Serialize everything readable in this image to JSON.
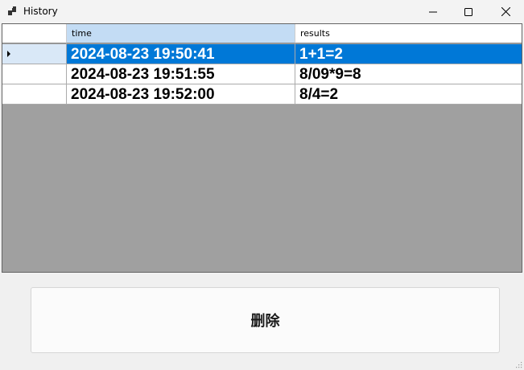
{
  "window": {
    "title": "History",
    "icons": {
      "app": "app-icon",
      "minimize": "minimize-icon",
      "maximize": "maximize-icon",
      "close": "close-icon"
    }
  },
  "grid": {
    "columns": [
      "time",
      "results"
    ],
    "selected_row": 0,
    "rows": [
      {
        "time": "2024-08-23 19:50:41",
        "results": "1+1=2"
      },
      {
        "time": "2024-08-23 19:51:55",
        "results": "8/09*9=8"
      },
      {
        "time": "2024-08-23 19:52:00",
        "results": "8/4=2"
      }
    ]
  },
  "actions": {
    "delete_label": "删除"
  },
  "colors": {
    "selection": "#0078d7",
    "selected_header": "#c3dcf4",
    "empty_area": "#a0a0a0"
  }
}
